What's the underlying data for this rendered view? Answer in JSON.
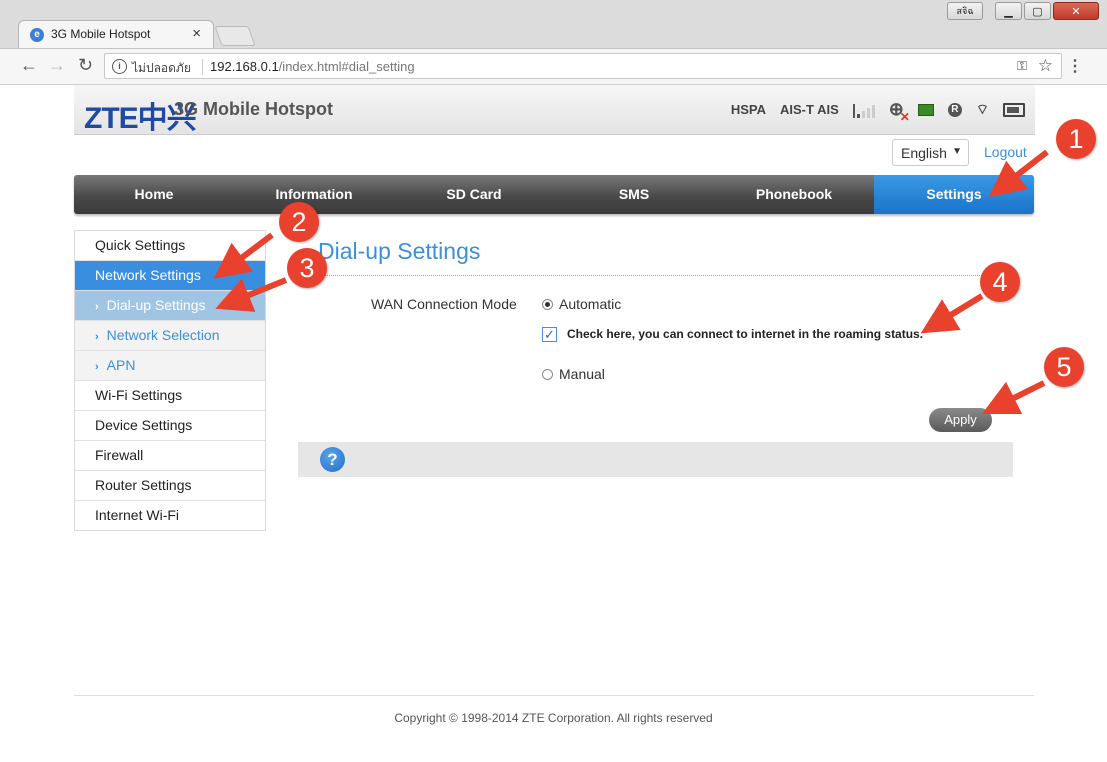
{
  "browser": {
    "tab_title": "3G Mobile Hotspot",
    "tab_close": "×",
    "security_text": "ไม่ปลอดภัย",
    "url_host": "192.168.0.1",
    "url_path": "/index.html#dial_setting",
    "window_user": "สจิฉ"
  },
  "header": {
    "logo": "ZTE中兴",
    "product_name": "3G Mobile Hotspot",
    "network_type": "HSPA",
    "operator_1": "AIS-T",
    "operator_2": "AIS"
  },
  "top_controls": {
    "language": "English",
    "logout": "Logout"
  },
  "main_nav": {
    "items": [
      "Home",
      "Information",
      "SD Card",
      "SMS",
      "Phonebook",
      "Settings"
    ],
    "active": "Settings"
  },
  "sidebar": {
    "items": [
      {
        "label": "Quick Settings"
      },
      {
        "label": "Network Settings"
      },
      {
        "label": "Dial-up Settings"
      },
      {
        "label": "Network Selection"
      },
      {
        "label": "APN"
      },
      {
        "label": "Wi-Fi Settings"
      },
      {
        "label": "Device Settings"
      },
      {
        "label": "Firewall"
      },
      {
        "label": "Router Settings"
      },
      {
        "label": "Internet Wi-Fi"
      }
    ]
  },
  "content": {
    "title": "Dial-up Settings",
    "wan_label": "WAN Connection Mode",
    "option_auto": "Automatic",
    "roaming_text": "Check here, you can connect to internet in the roaming status.",
    "option_manual": "Manual",
    "apply": "Apply",
    "help": "?"
  },
  "footer": {
    "copyright": "Copyright © 1998-2014 ZTE Corporation. All rights reserved"
  },
  "annotations": [
    "1",
    "2",
    "3",
    "4",
    "5"
  ],
  "colors": {
    "accent_blue": "#3d8fd6",
    "nav_dark": "#4a4a4a",
    "nav_active": "#1a73c8",
    "annotation_red": "#e8412d"
  }
}
